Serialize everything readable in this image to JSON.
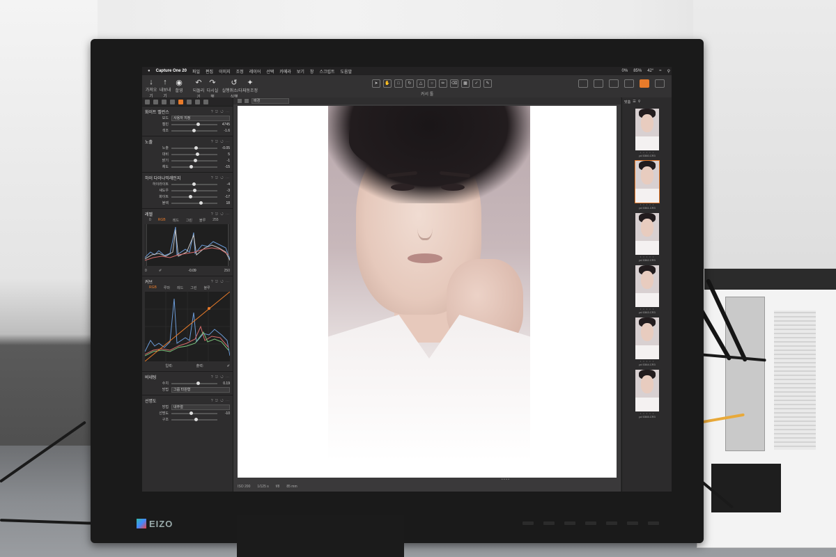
{
  "menubar": {
    "app_name": "Capture One 20",
    "items": [
      "파일",
      "편집",
      "이미지",
      "조정",
      "레이어",
      "선택",
      "카메라",
      "보기",
      "창",
      "스크립트",
      "도움말"
    ],
    "status_items": [
      "0%",
      "85%",
      "42°"
    ]
  },
  "toolbar": {
    "left_buttons": [
      "가져오기",
      "내보내기",
      "촬영"
    ],
    "history_buttons": [
      "되돌리기",
      "다시실행",
      "실행취소/다시실행"
    ],
    "auto_adjust": "자동조정",
    "cursor_tools_label": "커서 툴",
    "right_labels": [
      "전체화면",
      "노출경고",
      "교정"
    ]
  },
  "tools": {
    "white_balance": {
      "title": "화이트 밸런스",
      "mode_label": "모드",
      "mode_value": "사용자 지정",
      "rows": [
        {
          "label": "켈빈",
          "value": "4745",
          "pos": 0.55
        },
        {
          "label": "색조",
          "value": "-1.6",
          "pos": 0.45
        }
      ]
    },
    "exposure": {
      "title": "노출",
      "rows": [
        {
          "label": "노출",
          "value": "-0.05",
          "pos": 0.5
        },
        {
          "label": "대비",
          "value": "5",
          "pos": 0.53
        },
        {
          "label": "밝기",
          "value": "-1",
          "pos": 0.49
        },
        {
          "label": "채도",
          "value": "-15",
          "pos": 0.4
        }
      ]
    },
    "hdr": {
      "title": "하이 다이나믹레인지",
      "rows": [
        {
          "label": "하이라이트",
          "value": "-4",
          "pos": 0.46
        },
        {
          "label": "섀도우",
          "value": "-3",
          "pos": 0.47
        },
        {
          "label": "화이트",
          "value": "-17",
          "pos": 0.38
        },
        {
          "label": "블랙",
          "value": "18",
          "pos": 0.6
        }
      ]
    },
    "levels": {
      "title": "레벨",
      "channels": [
        "RGB",
        "레드",
        "그린",
        "블루"
      ],
      "top_left": "0",
      "top_right": "255",
      "bottom_left": "0",
      "mid": "-0.09",
      "bottom_right": "250"
    },
    "curve": {
      "title": "커브",
      "channels": [
        "RGB",
        "루마",
        "레드",
        "그린",
        "블루"
      ],
      "input_label": "입력:",
      "output_label": "출력:"
    },
    "vignetting": {
      "title": "비네팅",
      "amount_label": "수치",
      "amount_value": "0.19",
      "method_label": "방법",
      "method_value": "그룹 타원형"
    },
    "sharpening": {
      "title": "선명도",
      "method_label": "방법",
      "method_value": "내추럴",
      "rows": [
        {
          "label": "선명도",
          "value": "-10",
          "pos": 0.4
        },
        {
          "label": "구조",
          "value": "",
          "pos": 0.5
        }
      ]
    }
  },
  "viewer": {
    "style_field": "배경",
    "zoom_label": "맞춤",
    "status": [
      "ISO 200",
      "1/125 s",
      "f/8",
      "85 mm"
    ]
  },
  "browser": {
    "header": "맞춤",
    "thumbs": [
      {
        "name": "pd 0360.CR3",
        "active": false
      },
      {
        "name": "pd 0361.CR3",
        "active": true
      },
      {
        "name": "pd 0362.CR3",
        "active": false
      },
      {
        "name": "pd 0363.CR3",
        "active": false
      },
      {
        "name": "pd 0364.CR3",
        "active": false
      },
      {
        "name": "pd 0365.CR3",
        "active": false
      }
    ]
  },
  "monitor": {
    "brand": "EIZO"
  },
  "colors": {
    "accent": "#e87b2a",
    "panel": "#2e2d2e",
    "bezel": "#1a1a1a"
  }
}
